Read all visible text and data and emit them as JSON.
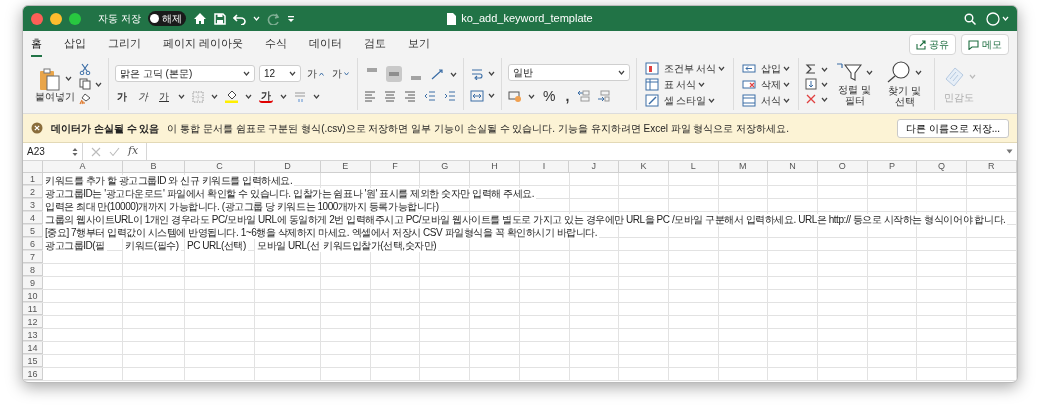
{
  "window": {
    "title": "ko_add_keyword_template"
  },
  "autosave": {
    "label": "자동 저장",
    "on": false,
    "state_text": "해제"
  },
  "ribbon_tabs": [
    {
      "label": "홈",
      "selected": true
    },
    {
      "label": "삽입",
      "selected": false
    },
    {
      "label": "그리기",
      "selected": false
    },
    {
      "label": "페이지 레이아웃",
      "selected": false
    },
    {
      "label": "수식",
      "selected": false
    },
    {
      "label": "데이터",
      "selected": false
    },
    {
      "label": "검토",
      "selected": false
    },
    {
      "label": "보기",
      "selected": false
    }
  ],
  "share_button": "공유",
  "comment_button": "메모",
  "ribbon": {
    "paste_label": "붙여넣기",
    "font_name": "맑은 고딕 (본문)",
    "font_size": "12",
    "font_size_buttons": [
      "가",
      "가"
    ],
    "font_style_buttons": [
      "가",
      "가",
      "가"
    ],
    "font_color_button": "가",
    "vertical_alignment": [
      {
        "selected": false
      },
      {
        "selected": true
      },
      {
        "selected": false
      }
    ],
    "number_format": "일반",
    "number_buttons": [
      "%",
      ","
    ],
    "style_buttons": [
      "조건부 서식",
      "표 서식",
      "셀 스타일"
    ],
    "cell_buttons": [
      "삽입",
      "삭제",
      "서식"
    ],
    "sort_filter": "정렬 및 필터",
    "find_select": "찾기 및 선택",
    "sensitivity": {
      "label": "민감도",
      "disabled": true
    }
  },
  "message_bar": {
    "title": "데이터가 손실될 수 있음",
    "text": "이 통합 문서를 쉼표로 구분된 형식(.csv)으로 저장하면 일부 기능이 손실될 수 있습니다. 기능을 유지하려면 Excel 파일 형식으로 저장하세요.",
    "button": "다른 이름으로 저장..."
  },
  "formula_bar": {
    "name_box": "A23",
    "function_label": "fx"
  },
  "sheet": {
    "columns": [
      "A",
      "B",
      "C",
      "D",
      "E",
      "F",
      "G",
      "H",
      "I",
      "J",
      "K",
      "L",
      "M",
      "N",
      "O",
      "P",
      "Q",
      "R"
    ],
    "rows": [
      {
        "header": "1",
        "cells": [
          "키워드를 추가 할 광고그룹ID 와 신규 키워드를 입력하세요."
        ]
      },
      {
        "header": "2",
        "cells": [
          "광고그룹ID는 '광고다운로드' 파일에서 확인할 수 있습니다. 입찰가는 쉼표나 '원' 표시를 제외한 숫자만 입력해 주세요."
        ]
      },
      {
        "header": "3",
        "cells": [
          "입력은 최대 만(10000)개까지 가능합니다. (광고그룹 당 키워드는 1000개까지 등록가능합니다)"
        ]
      },
      {
        "header": "4",
        "cells": [
          "그룹의 웹사이트URL이 1개인 경우라도 PC/모바일 URL에 동일하게 2번 입력해주시고 PC/모바일 웹사이트를 별도로 가지고 있는 경우에만 URL을 PC /모바일 구분해서 입력하세요. URL은 http:// 등으로 시작하는 형식이어야 합니다."
        ]
      },
      {
        "header": "5",
        "cells": [
          "[중요] 7행부터 입력값이 시스템에 반영됩니다. 1~6행을 삭제하지 마세요. 엑셀에서 저장시 CSV 파일형식을 꼭 확인하시기 바랍니다."
        ]
      },
      {
        "header": "6",
        "cells": [
          "광고그룹ID(필",
          "키워드(필수)",
          "PC URL(선택)",
          "모바일 URL(선",
          "키워드입찰가(선택,숫자만)"
        ]
      },
      {
        "header": "7"
      },
      {
        "header": "8"
      },
      {
        "header": "9"
      },
      {
        "header": "10"
      },
      {
        "header": "11"
      },
      {
        "header": "12"
      },
      {
        "header": "13"
      },
      {
        "header": "14"
      },
      {
        "header": "15"
      },
      {
        "header": "16"
      }
    ]
  }
}
